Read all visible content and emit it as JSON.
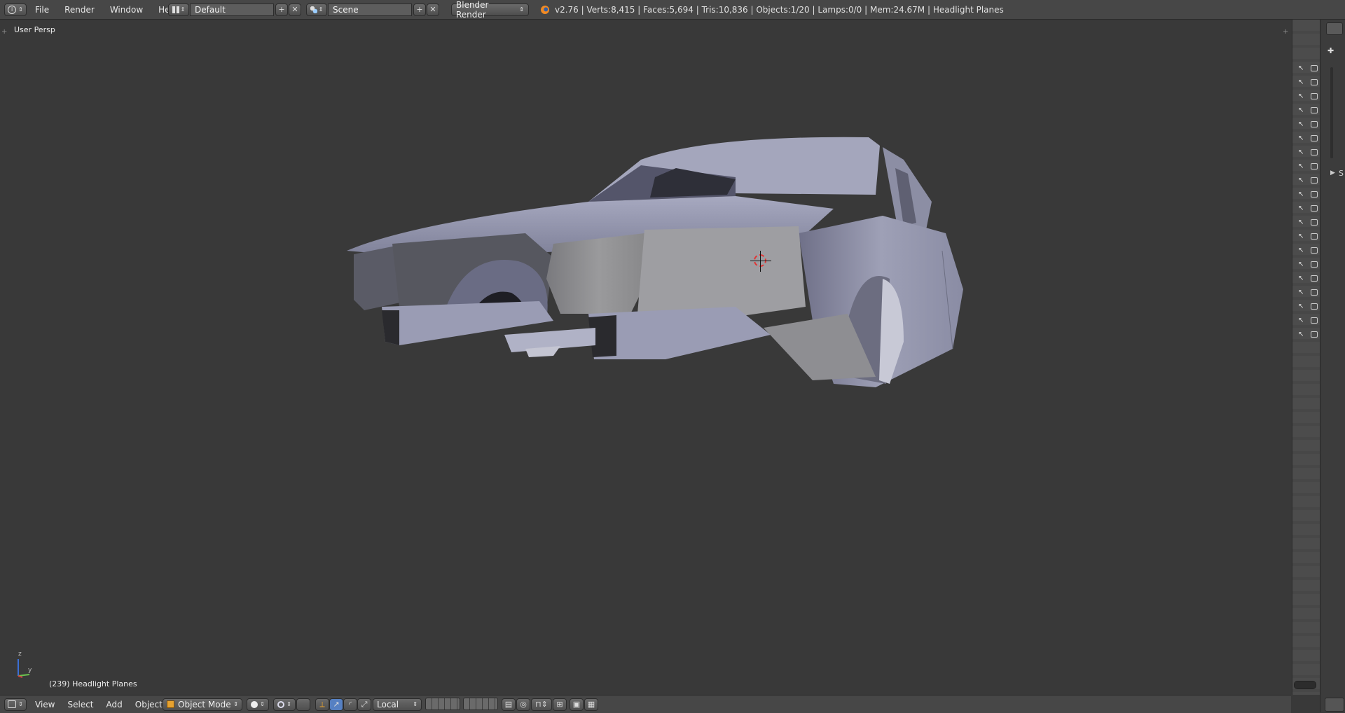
{
  "menubar": {
    "items": [
      "File",
      "Render",
      "Window",
      "Help"
    ],
    "screen_layout": "Default",
    "scene": "Scene",
    "render_engine": "Blender Render",
    "stats": "v2.76 | Verts:8,415 | Faces:5,694 | Tris:10,836 | Objects:1/20 | Lamps:0/0 | Mem:24.67M | Headlight Planes"
  },
  "viewport": {
    "view_label": "User Persp",
    "object_label": "(239) Headlight Planes",
    "axis_z": "z",
    "axis_y": "y"
  },
  "header3d": {
    "menus": [
      "View",
      "Select",
      "Add",
      "Object"
    ],
    "mode": "Object Mode",
    "pivot_orientation": "Local"
  },
  "right_panel": {
    "label_fragment": "S",
    "row_count": 20
  },
  "colors": {
    "background": "#393939",
    "header": "#474747",
    "mesh": "#9a9cb4"
  }
}
